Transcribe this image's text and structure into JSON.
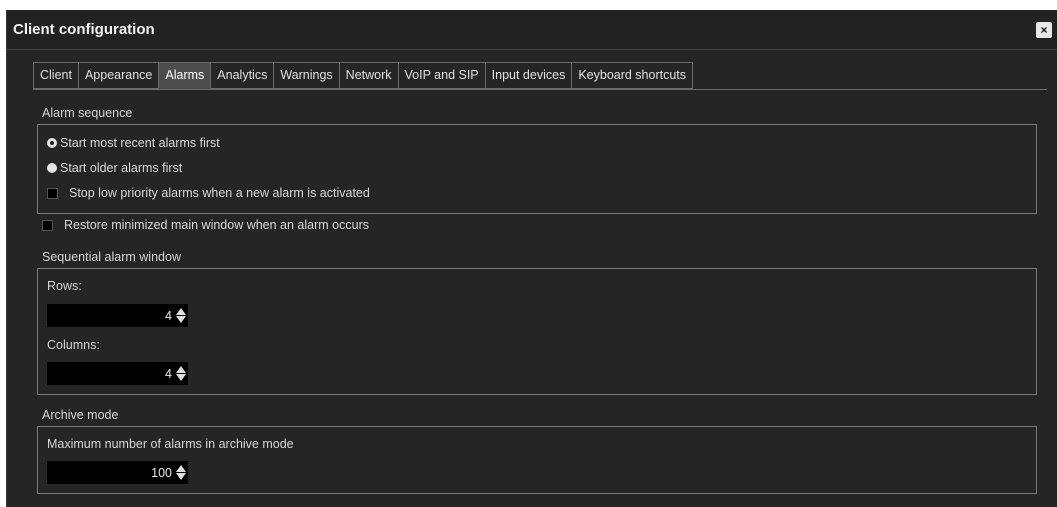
{
  "window": {
    "title": "Client configuration",
    "close_glyph": "×"
  },
  "tabs": [
    {
      "label": "Client",
      "active": false
    },
    {
      "label": "Appearance",
      "active": false
    },
    {
      "label": "Alarms",
      "active": true
    },
    {
      "label": "Analytics",
      "active": false
    },
    {
      "label": "Warnings",
      "active": false
    },
    {
      "label": "Network",
      "active": false
    },
    {
      "label": "VoIP and SIP",
      "active": false
    },
    {
      "label": "Input devices",
      "active": false
    },
    {
      "label": "Keyboard shortcuts",
      "active": false
    }
  ],
  "alarm_sequence": {
    "label": "Alarm sequence",
    "options": [
      {
        "label": "Start most recent alarms first",
        "selected": true
      },
      {
        "label": "Start older alarms first",
        "selected": false
      }
    ],
    "stop_low_priority": {
      "label": "Stop low priority alarms when a new alarm is activated",
      "checked": false
    }
  },
  "restore_minimized": {
    "label": "Restore minimized main window when an alarm occurs",
    "checked": false
  },
  "sequential_window": {
    "label": "Sequential alarm window",
    "rows_label": "Rows:",
    "rows_value": "4",
    "columns_label": "Columns:",
    "columns_value": "4"
  },
  "archive_mode": {
    "label": "Archive mode",
    "max_label": "Maximum number of alarms in archive mode",
    "max_value": "100"
  },
  "colors": {
    "background": "#252525",
    "active_tab": "#4d4d4d",
    "border": "#7a7a7a",
    "input_bg": "#000000"
  }
}
